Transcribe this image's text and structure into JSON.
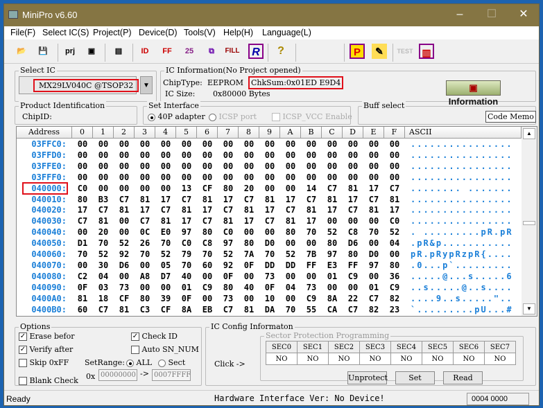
{
  "window": {
    "title": "MiniPro v6.60",
    "minimize": "–",
    "maximize": "☐",
    "close": "✕"
  },
  "menu": [
    "File(F)",
    "Select IC(S)",
    "Project(P)",
    "Device(D)",
    "Tools(V)",
    "Help(H)",
    "Language(L)"
  ],
  "toolbar": {
    "open": "📂",
    "save": "💾",
    "prj": "prj",
    "save_prj": "▣",
    "chip": "▤",
    "read_id": "ID",
    "verify_ff": "FF",
    "blank": "25",
    "program": "⧉",
    "fill": "FILL",
    "read": "R",
    "help": "?",
    "prog_p": "P",
    "edit": "✎",
    "test": "TEST",
    "pins": "▥"
  },
  "select_ic": {
    "label": "Select IC",
    "value": "MX29LV040C @TSOP32",
    "dropdown": "▼"
  },
  "ic_info": {
    "label": "IC Information(No Project opened)",
    "chip_type_label": "ChipType:",
    "chip_type": "EEPROM",
    "checksum": "ChkSum:0x01ED E9D4",
    "ic_size_label": "IC Size:",
    "ic_size": "0x80000 Bytes",
    "info_button": "Information"
  },
  "product": {
    "label": "Product Identification",
    "chipid_label": "ChipID:"
  },
  "interface": {
    "label": "Set Interface",
    "opt1": "40P adapter",
    "opt2": "ICSP port",
    "opt3": "ICSP_VCC Enable"
  },
  "buff": {
    "label": "Buff select",
    "code_memo": "Code Memo"
  },
  "hex": {
    "headers": [
      "Address",
      "0",
      "1",
      "2",
      "3",
      "4",
      "5",
      "6",
      "7",
      "8",
      "9",
      "A",
      "B",
      "C",
      "D",
      "E",
      "F",
      "ASCII"
    ],
    "rows": [
      {
        "addr": "03FFC0:",
        "bytes": [
          "00",
          "00",
          "00",
          "00",
          "00",
          "00",
          "00",
          "00",
          "00",
          "00",
          "00",
          "00",
          "00",
          "00",
          "00",
          "00"
        ],
        "ascii": "................"
      },
      {
        "addr": "03FFD0:",
        "bytes": [
          "00",
          "00",
          "00",
          "00",
          "00",
          "00",
          "00",
          "00",
          "00",
          "00",
          "00",
          "00",
          "00",
          "00",
          "00",
          "00"
        ],
        "ascii": "................"
      },
      {
        "addr": "03FFE0:",
        "bytes": [
          "00",
          "00",
          "00",
          "00",
          "00",
          "00",
          "00",
          "00",
          "00",
          "00",
          "00",
          "00",
          "00",
          "00",
          "00",
          "00"
        ],
        "ascii": "................"
      },
      {
        "addr": "03FFF0:",
        "bytes": [
          "00",
          "00",
          "00",
          "00",
          "00",
          "00",
          "00",
          "00",
          "00",
          "00",
          "00",
          "00",
          "00",
          "00",
          "00",
          "00"
        ],
        "ascii": "................"
      },
      {
        "addr": "040000:",
        "bytes": [
          "C0",
          "00",
          "00",
          "00",
          "00",
          "13",
          "CF",
          "80",
          "20",
          "00",
          "00",
          "14",
          "C7",
          "81",
          "17",
          "C7"
        ],
        "ascii": "........ ......."
      },
      {
        "addr": "040010:",
        "bytes": [
          "80",
          "B3",
          "C7",
          "81",
          "17",
          "C7",
          "81",
          "17",
          "C7",
          "81",
          "17",
          "C7",
          "81",
          "17",
          "C7",
          "81"
        ],
        "ascii": "................"
      },
      {
        "addr": "040020:",
        "bytes": [
          "17",
          "C7",
          "81",
          "17",
          "C7",
          "81",
          "17",
          "C7",
          "81",
          "17",
          "C7",
          "81",
          "17",
          "C7",
          "81",
          "17"
        ],
        "ascii": "................"
      },
      {
        "addr": "040030:",
        "bytes": [
          "C7",
          "81",
          "00",
          "C7",
          "81",
          "17",
          "C7",
          "81",
          "17",
          "C7",
          "81",
          "17",
          "00",
          "00",
          "00",
          "C0"
        ],
        "ascii": "................"
      },
      {
        "addr": "040040:",
        "bytes": [
          "00",
          "20",
          "00",
          "0C",
          "E0",
          "97",
          "80",
          "C0",
          "00",
          "00",
          "80",
          "70",
          "52",
          "C8",
          "70",
          "52"
        ],
        "ascii": ". .........pR.pR"
      },
      {
        "addr": "040050:",
        "bytes": [
          "D1",
          "70",
          "52",
          "26",
          "70",
          "C0",
          "C8",
          "97",
          "80",
          "D0",
          "00",
          "00",
          "80",
          "D6",
          "00",
          "04"
        ],
        "ascii": ".pR&p..........."
      },
      {
        "addr": "040060:",
        "bytes": [
          "70",
          "52",
          "92",
          "70",
          "52",
          "79",
          "70",
          "52",
          "7A",
          "70",
          "52",
          "7B",
          "97",
          "80",
          "D0",
          "00"
        ],
        "ascii": "pR.pRypRzpR{...."
      },
      {
        "addr": "040070:",
        "bytes": [
          "00",
          "30",
          "D6",
          "00",
          "05",
          "70",
          "60",
          "92",
          "0F",
          "DD",
          "DD",
          "FF",
          "E3",
          "FF",
          "97",
          "80"
        ],
        "ascii": ".0...p`........."
      },
      {
        "addr": "040080:",
        "bytes": [
          "C2",
          "04",
          "00",
          "A8",
          "D7",
          "40",
          "00",
          "0F",
          "00",
          "73",
          "00",
          "00",
          "01",
          "C9",
          "00",
          "36"
        ],
        "ascii": ".....@...s.....6"
      },
      {
        "addr": "040090:",
        "bytes": [
          "0F",
          "03",
          "73",
          "00",
          "00",
          "01",
          "C9",
          "80",
          "40",
          "0F",
          "04",
          "73",
          "00",
          "00",
          "01",
          "C9"
        ],
        "ascii": "..s.....@..s...."
      },
      {
        "addr": "0400A0:",
        "bytes": [
          "81",
          "18",
          "CF",
          "80",
          "39",
          "0F",
          "00",
          "73",
          "00",
          "10",
          "00",
          "C9",
          "8A",
          "22",
          "C7",
          "82"
        ],
        "ascii": "....9..s.....\".."
      },
      {
        "addr": "0400B0:",
        "bytes": [
          "60",
          "C7",
          "81",
          "C3",
          "CF",
          "8A",
          "EB",
          "C7",
          "81",
          "DA",
          "70",
          "55",
          "CA",
          "C7",
          "82",
          "23"
        ],
        "ascii": "`.........pU...#"
      }
    ],
    "highlight_row": 4,
    "scroll_up": "▲",
    "scroll_down": "▼"
  },
  "options": {
    "label": "Options",
    "erase": "Erase befor",
    "verify": "Verify after",
    "skip": "Skip 0xFF",
    "blank": "Blank Check",
    "check_id": "Check ID",
    "auto_sn": "Auto SN_NUM",
    "setrange": "SetRange:",
    "all": "ALL",
    "sect": "Sect",
    "ox": "0x",
    "from": "00000000",
    "arrow": "->",
    "to": "0007FFFF",
    "erase_checked": true,
    "verify_checked": true,
    "skip_checked": false,
    "blank_checked": false,
    "check_id_checked": true,
    "auto_sn_checked": false
  },
  "ic_config": {
    "label": "IC Config Informaton",
    "sub_label": "Sector Protection Programming",
    "click": "Click ->",
    "sectors": [
      "SEC0",
      "SEC1",
      "SEC2",
      "SEC3",
      "SEC4",
      "SEC5",
      "SEC6",
      "SEC7"
    ],
    "values": [
      "NO",
      "NO",
      "NO",
      "NO",
      "NO",
      "NO",
      "NO",
      "NO"
    ],
    "unprotect": "Unprotect",
    "set": "Set",
    "read": "Read"
  },
  "status": {
    "left": "Ready",
    "center": "Hardware Interface Ver: No Device!",
    "right": "0004 0000"
  }
}
